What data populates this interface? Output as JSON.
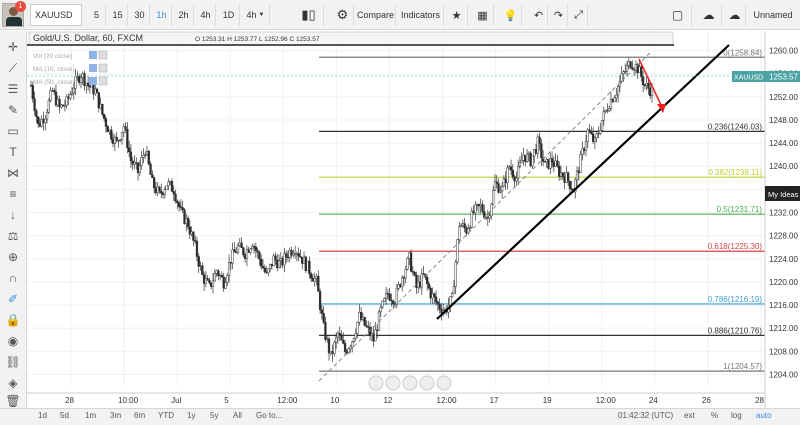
{
  "toolbar": {
    "notification_count": "1",
    "symbol": "XAUUSD",
    "intervals": [
      "5",
      "15",
      "30",
      "1h",
      "2h",
      "4h",
      "1D",
      "4h"
    ],
    "active_interval": "1h",
    "compare_label": "Compare",
    "indicators_label": "Indicators",
    "layout_name": "Unnamed",
    "icons": [
      "bar-style-icon",
      "gear-icon",
      "star-icon",
      "templates-icon",
      "lightbulb-icon",
      "undo-icon",
      "redo-icon",
      "fullscreen-icon",
      "snapshot-icon",
      "cloud-icon",
      "upload-icon"
    ]
  },
  "sidebar": {
    "icons": [
      "crosshair-icon",
      "trendline-icon",
      "fib-lines-icon",
      "pen-icon",
      "rectangle-icon",
      "text-icon",
      "pattern-icon",
      "fib-channel-icon",
      "arrow-down-icon",
      "ruler-icon",
      "zoom-icon",
      "magnet-icon",
      "drawing-mode-icon",
      "lock-icon",
      "visibility-icon",
      "link-icon",
      "layers-icon",
      "trash-icon"
    ]
  },
  "legend": {
    "title": "Gold/U.S. Dollar, 60, FXCM",
    "ohlc": "O 1253.31  H 1253.77  L 1252.96  C 1253.57",
    "study_rows": [
      "Vol (20 close)",
      "MA (10, close)",
      "MA (50, close)"
    ]
  },
  "chart_data": {
    "type": "candlestick",
    "symbol": "XAUUSD",
    "last_price": "1253.57",
    "my_ideas_label": "My Ideas",
    "ylim": [
      1202,
      1262
    ],
    "y_ticks": [
      "1260.00",
      "1256.00",
      "1252.00",
      "1248.00",
      "1244.00",
      "1240.00",
      "1236.00",
      "1232.00",
      "1228.00",
      "1224.00",
      "1220.00",
      "1216.00",
      "1212.00",
      "1208.00",
      "1204.00"
    ],
    "x_ticks": [
      "28",
      "10:00",
      "Jul",
      "5",
      "12:00",
      "10",
      "12",
      "12:00",
      "17",
      "19",
      "12:00",
      "24",
      "26",
      "28"
    ],
    "fib_levels": [
      {
        "ratio": "0",
        "price": 1258.84,
        "label": "0(1258.84)",
        "color": "#777777"
      },
      {
        "ratio": "0.236",
        "price": 1246.03,
        "label": "0.236(1246.03)",
        "color": "#333333"
      },
      {
        "ratio": "0.382",
        "price": 1238.11,
        "label": "0.382(1238.11)",
        "color": "#c2d12f"
      },
      {
        "ratio": "0.5",
        "price": 1231.71,
        "label": "0.5(1231.71)",
        "color": "#4cb050"
      },
      {
        "ratio": "0.618",
        "price": 1225.3,
        "label": "0.618(1225.30)",
        "color": "#d64545"
      },
      {
        "ratio": "0.786",
        "price": 1216.19,
        "label": "0.786(1216.19)",
        "color": "#3a9fd6"
      },
      {
        "ratio": "0.886",
        "price": 1210.76,
        "label": "0.886(1210.76)",
        "color": "#333333"
      },
      {
        "ratio": "1",
        "price": 1204.57,
        "label": "1(1204.57)",
        "color": "#777777"
      }
    ],
    "price_path": [
      1254,
      1247,
      1249,
      1253,
      1250,
      1251,
      1254,
      1256,
      1254,
      1253,
      1249,
      1246,
      1244,
      1247,
      1241,
      1239,
      1243,
      1237,
      1235,
      1237,
      1236,
      1232,
      1230,
      1226,
      1221,
      1219,
      1222,
      1220,
      1224,
      1226,
      1225,
      1227,
      1224,
      1221,
      1224,
      1223,
      1225,
      1226,
      1224,
      1222,
      1220,
      1212,
      1207,
      1211,
      1208,
      1210,
      1214,
      1212,
      1210,
      1215,
      1218,
      1217,
      1221,
      1224,
      1219,
      1221,
      1218,
      1216,
      1215,
      1217,
      1230,
      1229,
      1232,
      1233,
      1231,
      1237,
      1236,
      1240,
      1238,
      1242,
      1241,
      1244,
      1240,
      1241,
      1239,
      1238,
      1236,
      1241,
      1246,
      1244,
      1248,
      1251,
      1253,
      1256,
      1258,
      1257,
      1254,
      1253
    ]
  },
  "bottom": {
    "ranges": [
      "1d",
      "5d",
      "1m",
      "3m",
      "6m",
      "YTD",
      "1y",
      "5y",
      "All",
      "Go to..."
    ],
    "clock": "01:42:32 (UTC)",
    "right": [
      "ext",
      "%",
      "log",
      "auto"
    ]
  }
}
